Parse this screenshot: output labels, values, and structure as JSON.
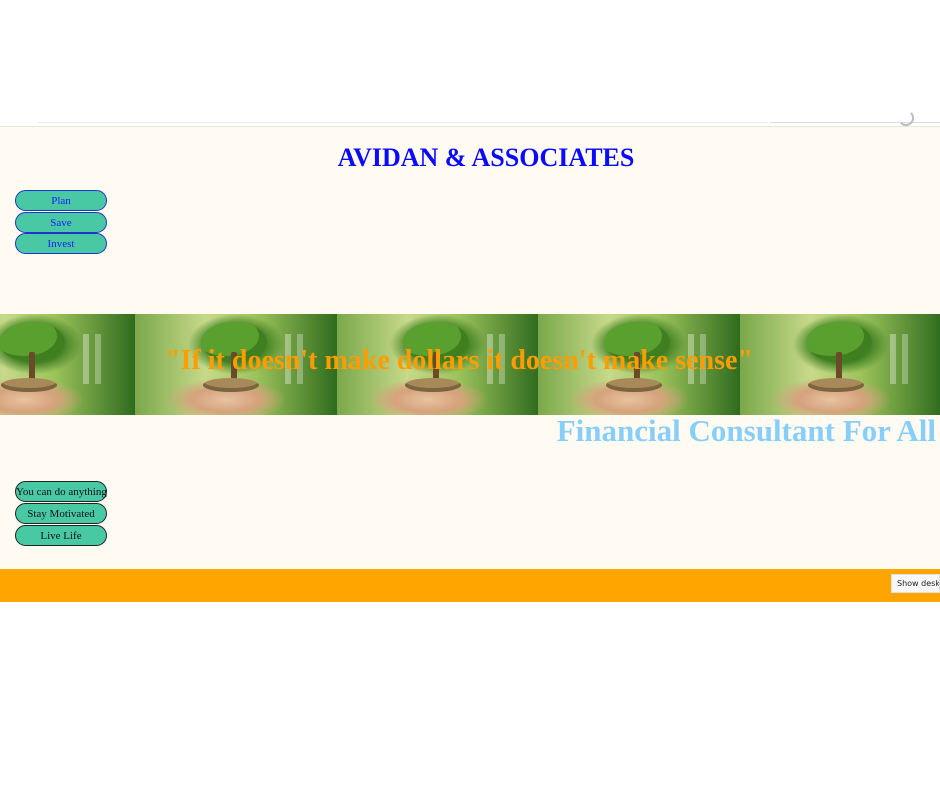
{
  "site": {
    "title": "AVIDAN & ASSOCIATES",
    "quote": "\"If it doesn't make dollars it doesn't make sense\"",
    "tagline": "Financial Consultant For All",
    "footer_text": "",
    "colors": {
      "title": "#0a0aff",
      "quote": "#ff9c00",
      "tagline": "#87cefa",
      "pill": "#48c9a4",
      "footer": "#ffa500",
      "page_background": "#fffaf2"
    }
  },
  "nav_buttons": [
    {
      "label": "Plan"
    },
    {
      "label": "Save"
    },
    {
      "label": "Invest"
    }
  ],
  "motivation_buttons": [
    {
      "label": "You can do anything"
    },
    {
      "label": "Stay Motivated"
    },
    {
      "label": "Live Life"
    }
  ],
  "banner": {
    "image_subject": "tree-growing-from-coins-in-hands",
    "tile_count": 5
  },
  "taskbar": {
    "tooltip": "Show deskto"
  }
}
